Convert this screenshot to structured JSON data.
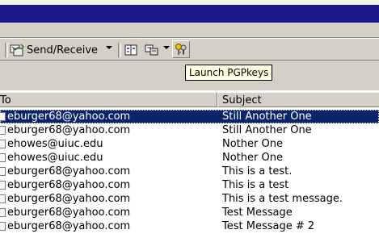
{
  "toolbar": {
    "send_receive_label": "Send/Receive"
  },
  "tooltip": {
    "text": "Launch PGPkeys"
  },
  "columns": {
    "to": "To",
    "subject": "Subject"
  },
  "messages": [
    {
      "to": "eburger68@yahoo.com",
      "subject": "Still Another One",
      "selected": true
    },
    {
      "to": "eburger68@yahoo.com",
      "subject": "Still Another One"
    },
    {
      "to": "ehowes@uiuc.edu",
      "subject": "Nother One"
    },
    {
      "to": "ehowes@uiuc.edu",
      "subject": "Nother One"
    },
    {
      "to": "eburger68@yahoo.com",
      "subject": "This is a test."
    },
    {
      "to": "eburger68@yahoo.com",
      "subject": "This is a test"
    },
    {
      "to": "eburger68@yahoo.com",
      "subject": "This is a test message."
    },
    {
      "to": "eburger68@yahoo.com",
      "subject": "Test Message"
    },
    {
      "to": "eburger68@yahoo.com",
      "subject": "Test Message # 2"
    }
  ],
  "colors": {
    "titlebar": "#1a1a8a",
    "selection": "#0a246a",
    "tooltip_bg": "#ffffe1"
  }
}
